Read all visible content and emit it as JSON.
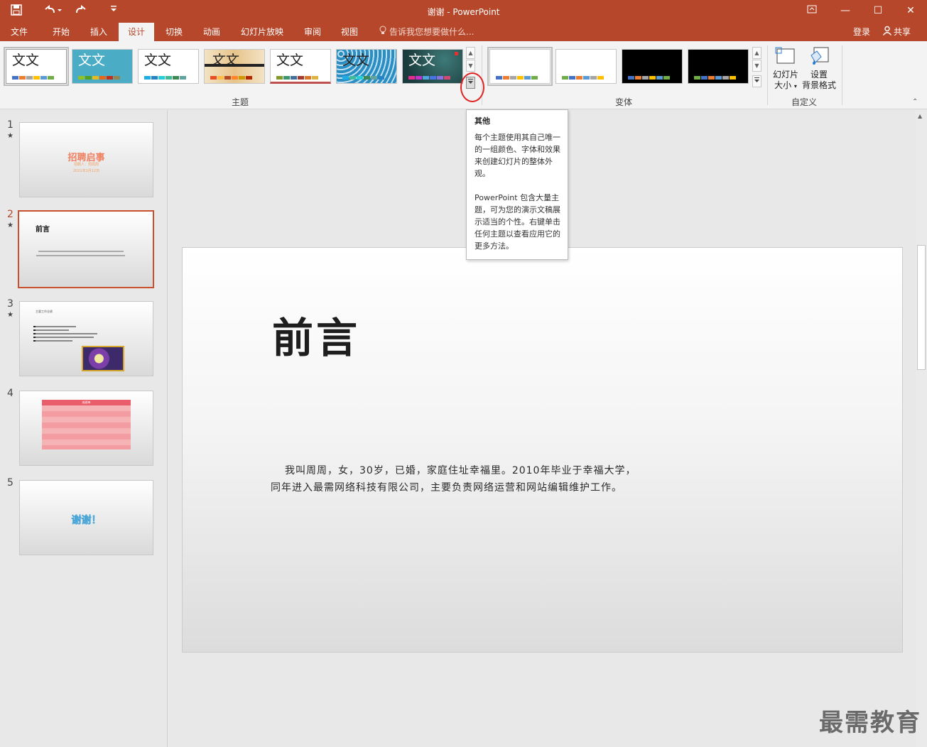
{
  "app": {
    "window_title": "谢谢 - PowerPoint"
  },
  "quick_access": {
    "save_icon": "save-icon",
    "undo_icon": "undo-icon",
    "redo_icon": "redo-icon",
    "customize_icon": "customize-icon"
  },
  "window_controls": {
    "ribbon_display": "ribbon-display-icon",
    "minimize": "—",
    "maximize": "☐",
    "close": "✕"
  },
  "tabs": [
    {
      "label": "文件"
    },
    {
      "label": "开始"
    },
    {
      "label": "插入"
    },
    {
      "label": "设计"
    },
    {
      "label": "切换"
    },
    {
      "label": "动画"
    },
    {
      "label": "幻灯片放映"
    },
    {
      "label": "审阅"
    },
    {
      "label": "视图"
    }
  ],
  "tell_me": {
    "placeholder": "告诉我您想要做什么..."
  },
  "account": {
    "signin": "登录",
    "share": "共享"
  },
  "ribbon": {
    "themes_group": "主题",
    "variants_group": "变体",
    "customize_group": "自定义",
    "theme_sample_text": "文文",
    "slide_size": {
      "line1": "幻灯片",
      "line2": "大小"
    },
    "format_bg": {
      "line1": "设置",
      "line2": "背景格式"
    }
  },
  "tooltip": {
    "title": "其他",
    "para1": "每个主题使用其自己唯一的一组颜色、字体和效果来创建幻灯片的整体外观。",
    "para2": "PowerPoint 包含大量主题，可为您的演示文稿展示适当的个性。右键单击任何主题以查看应用它的更多方法。"
  },
  "slides": [
    {
      "number": "1",
      "title": "招聘启事",
      "sub1": "招聘人：周周周",
      "sub2": "2021年1月12日"
    },
    {
      "number": "2",
      "title": "前言"
    },
    {
      "number": "3",
      "title": "主要工作业绩"
    },
    {
      "number": "4",
      "table_title": "成绩单"
    },
    {
      "number": "5",
      "title": "谢谢！"
    }
  ],
  "current_slide": {
    "title": "前言",
    "body_line1": "我叫周周，女，30岁，已婚，家庭住址幸福里。2010年毕业于幸福大学，",
    "body_line2": "同年进入最需网络科技有限公司，主要负责网络运营和网站编辑维护工作。"
  },
  "watermark": "最需教育",
  "colors": {
    "accent": "#b7472a",
    "selected_slide_border": "#c8502e",
    "highlight_circle": "#e02424"
  }
}
